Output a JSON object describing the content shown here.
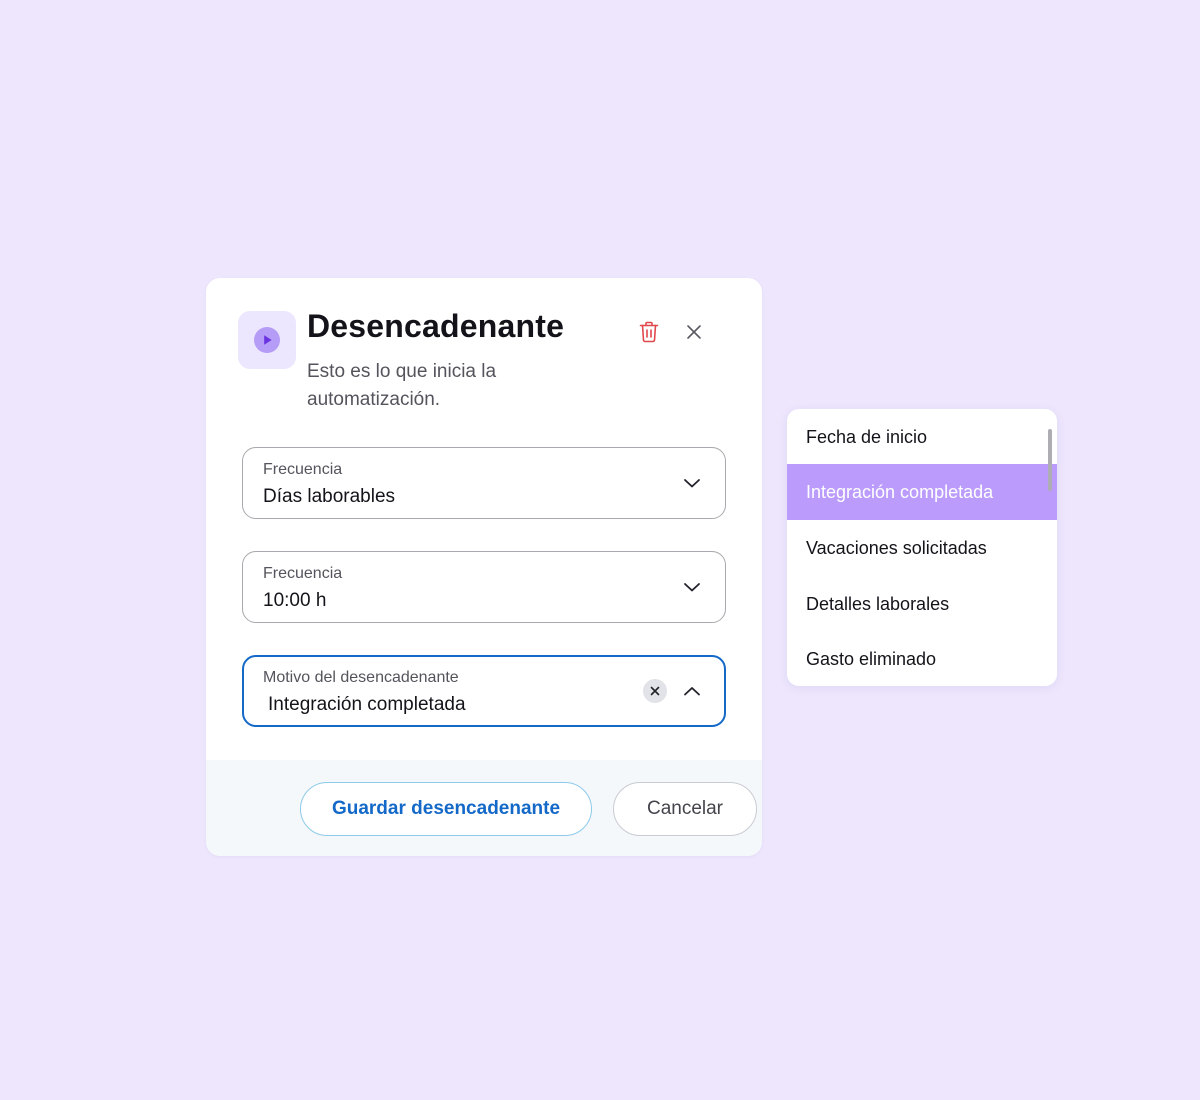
{
  "dialog": {
    "title": "Desencadenante",
    "subtitle": "Esto es lo que inicia la automatización.",
    "icons": {
      "header": "play-circle-icon",
      "delete": "trash-icon",
      "close": "close-icon"
    },
    "fields": [
      {
        "label": "Frecuencia",
        "value": "Días laborables",
        "state": "collapsed",
        "icon": "chevron-down-icon"
      },
      {
        "label": "Frecuencia",
        "value": "10:00 h",
        "state": "collapsed",
        "icon": "chevron-down-icon"
      },
      {
        "label": "Motivo del desencadenante",
        "value": "Integración completada",
        "state": "expanded",
        "icon": "chevron-up-icon",
        "clear_icon": "clear-icon"
      }
    ],
    "buttons": {
      "save": "Guardar desencadenante",
      "cancel": "Cancelar"
    }
  },
  "dropdown": {
    "options": [
      "Fecha de inicio",
      "Integración completada",
      "Vacaciones solicitadas",
      "Detalles laborales",
      "Gasto eliminado"
    ],
    "selected": "Integración completada"
  },
  "colors": {
    "background": "#ede6fd",
    "accent_blue": "#1469c8",
    "selected_option": "#bb9cfc",
    "icon_purple": "#7b4fe8",
    "delete_red": "#e0484d"
  }
}
